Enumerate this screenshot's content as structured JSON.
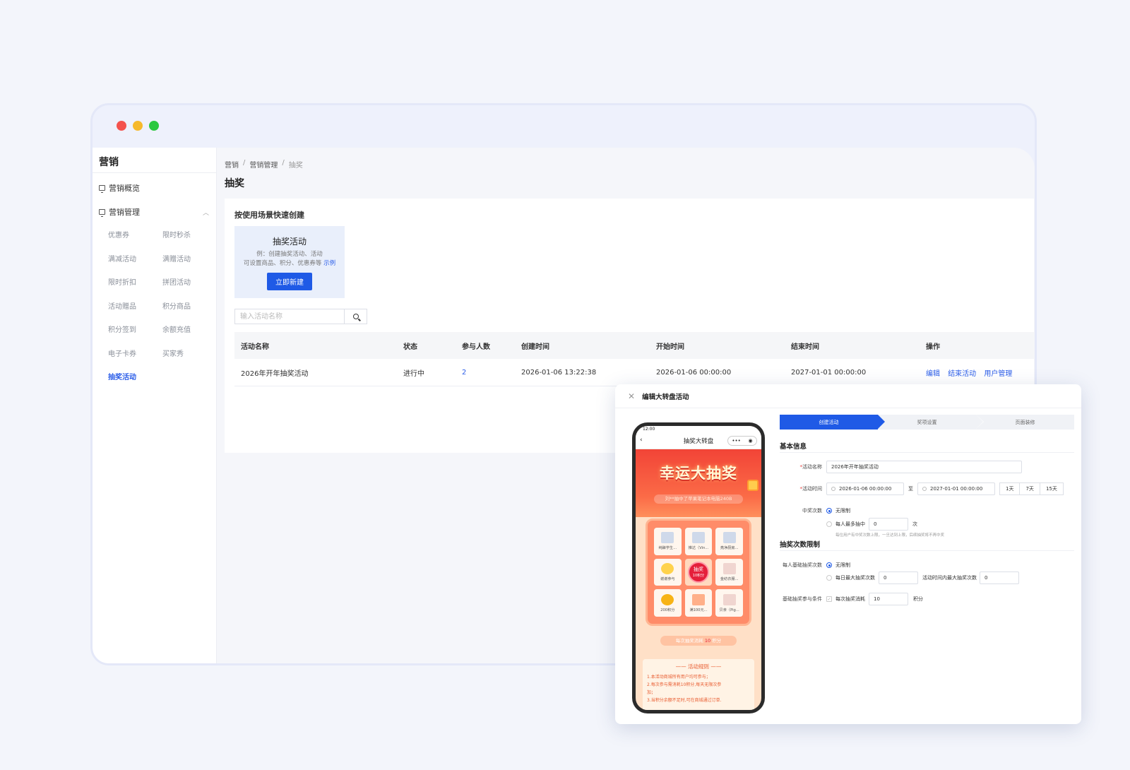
{
  "sidebar": {
    "title": "营销",
    "overview": "营销概览",
    "management": "营销管理",
    "subitems": [
      "优惠券",
      "限时秒杀",
      "满减活动",
      "满赠活动",
      "限时折扣",
      "拼团活动",
      "活动赠品",
      "积分商品",
      "积分签到",
      "余额充值",
      "电子卡券",
      "买家秀",
      "抽奖活动"
    ]
  },
  "breadcrumb": [
    "营销",
    "营销管理",
    "抽奖"
  ],
  "page_title": "抽奖",
  "quick_create": {
    "label": "按使用场景快速创建",
    "card_title": "抽奖活动",
    "card_desc_1": "例：创建抽奖活动、活动",
    "card_desc_2": "可设置商品、积分、优惠券等",
    "card_link": "示例",
    "card_button": "立即新建"
  },
  "search": {
    "placeholder": "输入活动名称"
  },
  "table": {
    "headers": [
      "活动名称",
      "状态",
      "参与人数",
      "创建时间",
      "开始时间",
      "结束时间",
      "操作"
    ],
    "rows": [
      {
        "name": "2026年开年抽奖活动",
        "status": "进行中",
        "participants": "2",
        "created": "2026-01-06 13:22:38",
        "start": "2026-01-06 00:00:00",
        "end": "2027-01-01 00:00:00",
        "ops": [
          "编辑",
          "结束活动",
          "用户管理"
        ]
      }
    ]
  },
  "dialog": {
    "title": "编辑大转盘活动",
    "phone": {
      "time": "12:00",
      "nav_title": "抽奖大转盘",
      "banner_title": "幸运大抽奖",
      "marquee": "刘**抽中了苹果笔记本电脑240B",
      "prizes": [
        "纯酿学生...",
        "推达（Vin...",
        "亮净厨房...",
        "谢谢参与",
        "金纺衣服...",
        "200积分",
        "满100元...",
        "贝亲（Pig..."
      ],
      "draw_label": "抽奖",
      "draw_cost": "10积分",
      "cost_prefix": "每次抽奖消耗",
      "cost_value": "10",
      "cost_suffix": "积分",
      "rules_title": "活动规则",
      "rules": [
        "1.本活动商城所有用户均可参与；",
        "2.每次参与需消耗10积分,每天无限次参",
        "加；",
        "3.当积分余额不足时,可在商城通过订单."
      ]
    },
    "steps": [
      "创建活动",
      "奖项设置",
      "页面装修"
    ],
    "basic_info": "基本信息",
    "activity_name_label": "活动名称",
    "activity_name_value": "2026年开年抽奖活动",
    "activity_time_label": "活动时间",
    "start_time": "2026-01-06 00:00:00",
    "to": "至",
    "end_time": "2027-01-01 00:00:00",
    "quick_days": [
      "1天",
      "7天",
      "15天"
    ],
    "win_count_label": "中奖次数",
    "unlimited": "无限制",
    "max_per_person": "每人最多抽中",
    "max_per_person_value": "0",
    "times_unit": "次",
    "win_hint": "每位用户有中奖次数上限，一旦达到上限，后续抽奖将不再中奖",
    "draw_limit_section": "抽奖次数限制",
    "base_draw_label": "每人基础抽奖次数",
    "daily_max": "每日最大抽奖次数",
    "daily_max_value": "0",
    "period_max": "活动时间内最大抽奖次数",
    "period_max_value": "0",
    "condition_label": "基础抽奖参与条件",
    "per_draw_cost": "每次抽奖消耗",
    "per_draw_cost_value": "10",
    "points_unit": "积分"
  }
}
